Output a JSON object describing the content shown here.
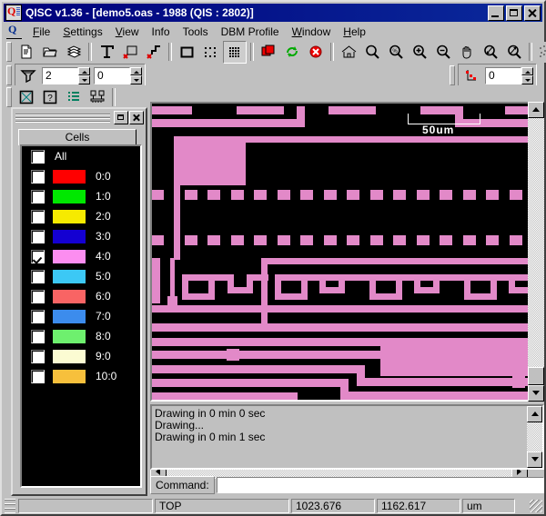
{
  "window": {
    "title": "QISC v1.36 - [demo5.oas - 1988 (QIS : 2802)]",
    "app_icon": "qisc-app-icon",
    "minimize": "minimize-icon",
    "maximize": "maximize-icon",
    "close": "close-icon"
  },
  "menu": {
    "items": [
      {
        "label": "File",
        "accel": "F"
      },
      {
        "label": "Settings",
        "accel": "S"
      },
      {
        "label": "View",
        "accel": "V"
      },
      {
        "label": "Info",
        "accel": ""
      },
      {
        "label": "Tools",
        "accel": ""
      },
      {
        "label": "DBM Profile",
        "accel": ""
      },
      {
        "label": "Window",
        "accel": "W"
      },
      {
        "label": "Help",
        "accel": "H"
      }
    ]
  },
  "toolbar_row1": {
    "groups": [
      [
        "new-file-icon",
        "open-folder-icon",
        "layers-stack-icon"
      ],
      [
        "text-tool-icon",
        "delete-box-icon",
        "delete-polygon-icon"
      ],
      [
        "rectangle-select-icon",
        "sparse-grid-icon",
        "dense-grid-icon"
      ],
      [
        "copy-shape-icon",
        "refresh-icon",
        "stop-icon"
      ],
      [
        "home-view-icon",
        "zoom-select-icon",
        "zoom-percent-icon",
        "zoom-in-icon",
        "zoom-out-icon",
        "pan-hand-icon",
        "zoom-previous-icon",
        "zoom-next-icon"
      ],
      [
        "query-area-icon",
        "query-point-icon",
        "query-box-icon",
        "query-edge-icon"
      ]
    ],
    "active": "dense-grid-icon"
  },
  "toolbar_row2": {
    "filter_icon": "funnel-filter-icon",
    "spinner_a": "2",
    "spinner_b": "0",
    "points_icon": "red-points-icon",
    "spinner_c": "0"
  },
  "toolbar_row3": {
    "icons": [
      "cross-box-icon",
      "question-box-icon",
      "green-list-icon",
      "chip-connect-icon"
    ]
  },
  "cells_panel": {
    "title_restore": "restore-icon",
    "title_close": "close-icon",
    "tab_label": "Cells",
    "rows": [
      {
        "label": "All",
        "color": "",
        "checked": false
      },
      {
        "label": "0:0",
        "color": "#ff0000",
        "checked": false
      },
      {
        "label": "1:0",
        "color": "#00e800",
        "checked": false
      },
      {
        "label": "2:0",
        "color": "#f6ea00",
        "checked": false
      },
      {
        "label": "3:0",
        "color": "#1400d2",
        "checked": false
      },
      {
        "label": "4:0",
        "color": "#fc8df0",
        "checked": true
      },
      {
        "label": "5:0",
        "color": "#3cc8f5",
        "checked": false
      },
      {
        "label": "6:0",
        "color": "#f96464",
        "checked": false
      },
      {
        "label": "7:0",
        "color": "#3c8ced",
        "checked": false
      },
      {
        "label": "8:0",
        "color": "#6ef06e",
        "checked": false
      },
      {
        "label": "9:0",
        "color": "#fbfbd2",
        "checked": false
      },
      {
        "label": "10:0",
        "color": "#f7c03c",
        "checked": false
      }
    ]
  },
  "canvas": {
    "background": "#000000",
    "shape_color": "#e289c8",
    "scale_label": "50um",
    "scroll_up": "scroll-up-icon",
    "scroll_down": "scroll-down-icon",
    "scroll_left": "scroll-left-icon",
    "scroll_right": "scroll-right-icon"
  },
  "log": {
    "lines": [
      "Drawing in 0 min 0 sec",
      "Drawing...",
      "Drawing in 0 min 1 sec"
    ],
    "scroll_up": "scroll-up-icon",
    "scroll_down": "scroll-down-icon"
  },
  "command": {
    "label": "Command:",
    "value": "",
    "placeholder": ""
  },
  "statusbar": {
    "cell": "TOP",
    "x": "1023.676",
    "y": "1162.617",
    "units": "um"
  }
}
